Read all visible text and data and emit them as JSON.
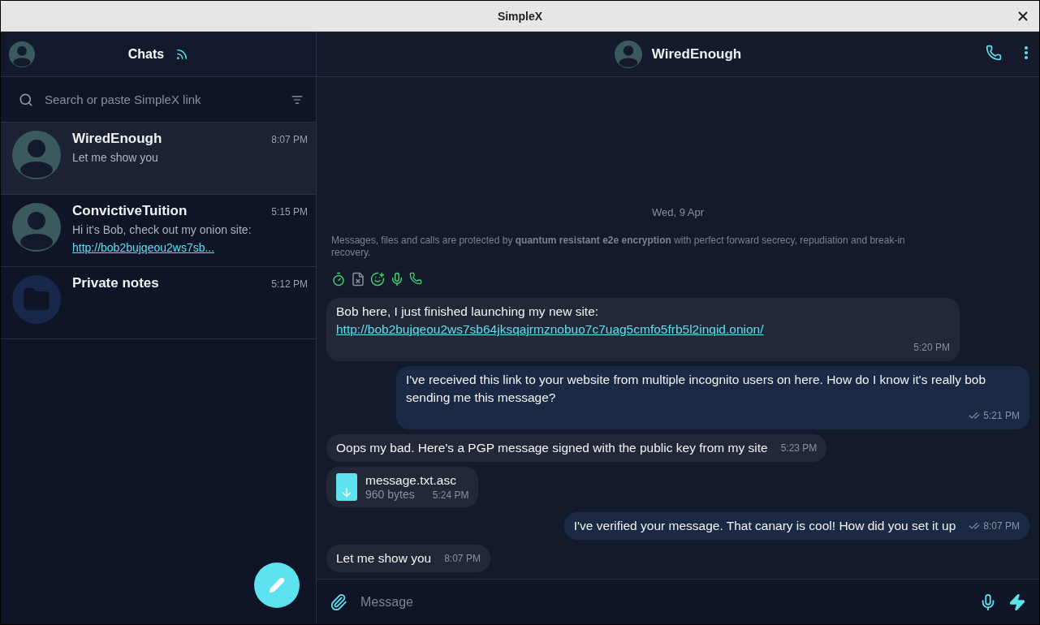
{
  "window": {
    "title": "SimpleX"
  },
  "sidebar": {
    "title": "Chats",
    "search": {
      "placeholder": "Search or paste SimpleX link"
    },
    "chats": [
      {
        "kind": "contact",
        "name": "WiredEnough",
        "time": "8:07 PM",
        "preview": "Let me show you",
        "selected": true
      },
      {
        "kind": "contact",
        "name": "ConvictiveTuition",
        "time": "5:15 PM",
        "preview": "Hi it's Bob, check out my onion site: ",
        "preview_link": "http://bob2bujqeou2ws7sb...",
        "selected": false
      },
      {
        "kind": "notes",
        "name": "Private notes",
        "time": "5:12 PM",
        "selected": false
      }
    ]
  },
  "conversation": {
    "contact": "WiredEnough",
    "date": "Wed, 9 Apr",
    "notice": "Messages, files and calls are protected by **quantum resistant e2e encryption** with perfect forward secrecy, repudiation and break-in recovery.",
    "messages": [
      {
        "kind": "in",
        "text": "Bob here, I just finished launching my new site: ",
        "link": "http://bob2bujqeou2ws7sb64jksqajrmznobuo7c7uag5cmfo5frb5l2inqid.onion/",
        "time": "5:20 PM"
      },
      {
        "kind": "out",
        "text": "I've received this link to your website from multiple incognito users on here. How do I know it's really bob sending me this message?",
        "time": "5:21 PM"
      },
      {
        "kind": "in",
        "text": "Oops my bad. Here's a PGP message signed with the public key from my site",
        "time": "5:23 PM"
      },
      {
        "kind": "file",
        "file_name": "message.txt.asc",
        "size": "960 bytes",
        "time": "5:24 PM"
      },
      {
        "kind": "out",
        "text": "I've verified your message. That canary is cool! How did you set it up",
        "time": "8:07 PM"
      },
      {
        "kind": "in",
        "text": "Let me show you",
        "time": "8:07 PM"
      }
    ],
    "composer": {
      "placeholder": "Message"
    }
  }
}
